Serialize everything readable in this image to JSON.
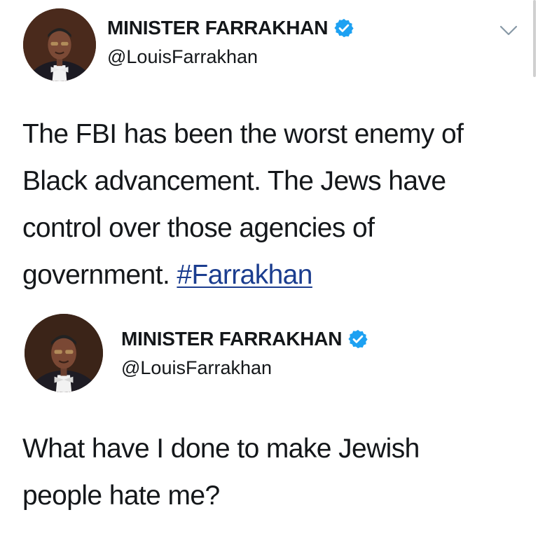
{
  "tweets": [
    {
      "display_name": "MINISTER FARRAKHAN",
      "handle": "@LouisFarrakhan",
      "verified_icon": "verified-badge-icon",
      "menu_icon": "chevron-down-icon",
      "text_lines": [
        "The FBI has been the worst enemy of",
        "Black advancement. The Jews have",
        "control over those agencies of"
      ],
      "last_line_text": "government. ",
      "hashtag": "#Farrakhan"
    },
    {
      "display_name": "MINISTER FARRAKHAN",
      "handle": "@LouisFarrakhan",
      "verified_icon": "verified-badge-icon",
      "text_lines": [
        "What have I done to make Jewish",
        "people hate me?"
      ]
    }
  ],
  "colors": {
    "verified_badge": "#1da1f2",
    "hashtag": "#1b3d8f",
    "text": "#14171a",
    "chevron": "#8899a6"
  }
}
